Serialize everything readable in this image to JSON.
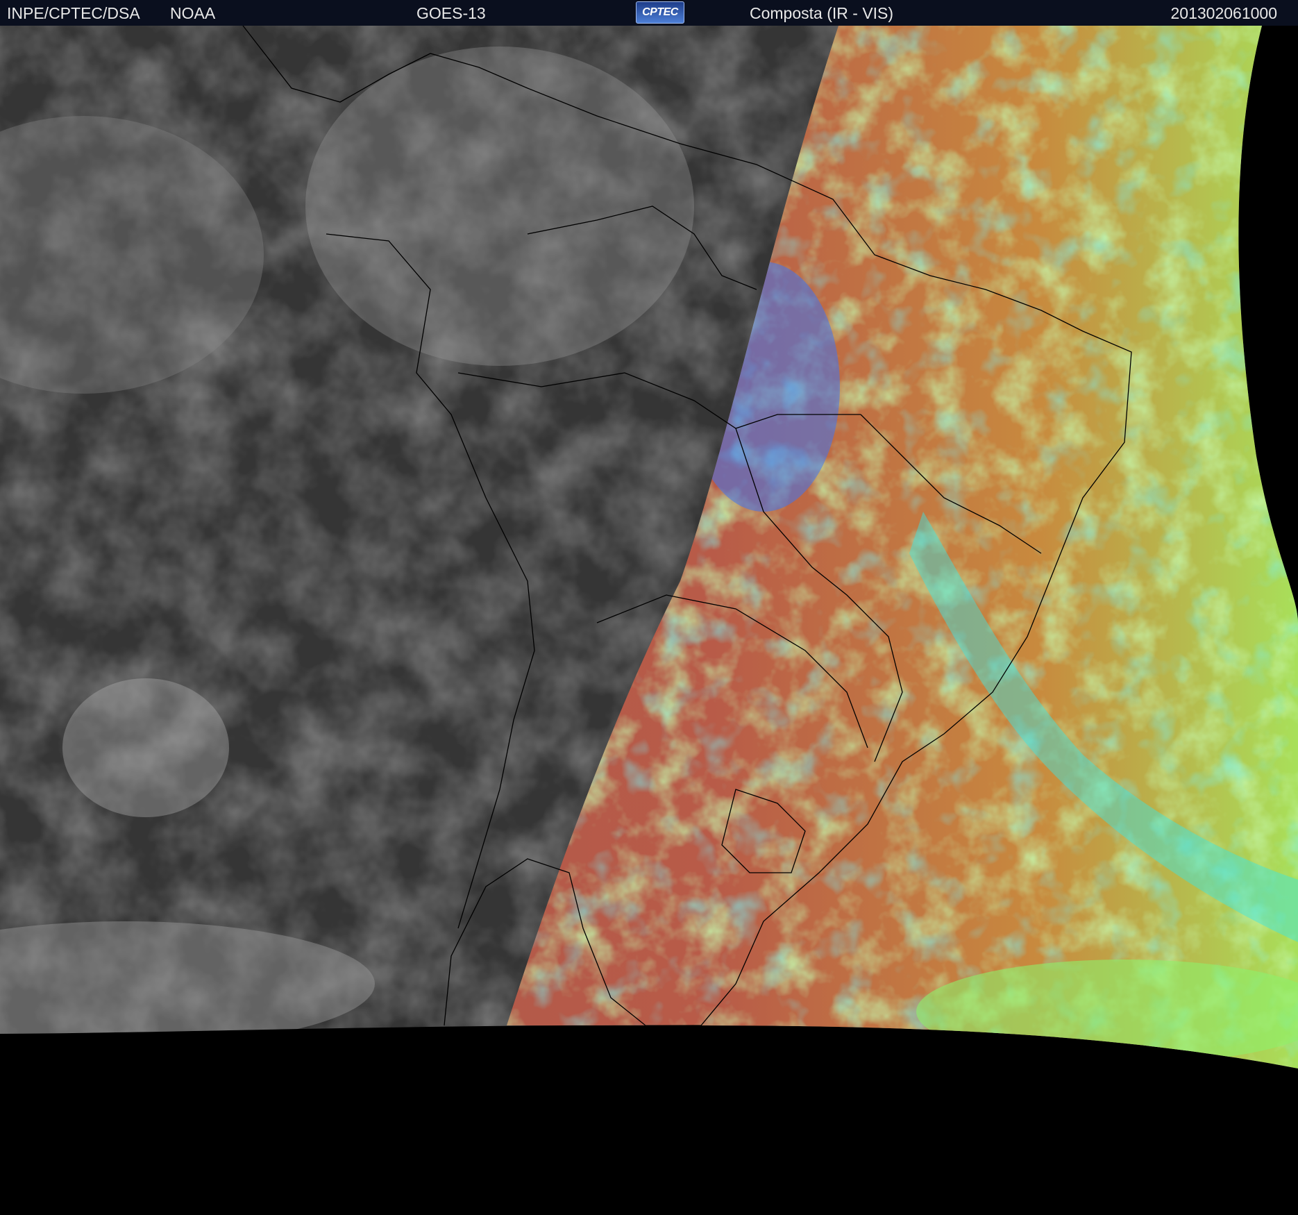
{
  "header": {
    "org": "INPE/CPTEC/DSA",
    "agency": "NOAA",
    "satellite": "GOES-13",
    "logo_text": "CPTEC",
    "product": "Composta (IR - VIS)",
    "timestamp": "201302061000"
  },
  "colors": {
    "header_bg": "#0a0f1e",
    "header_text": "#e8e8e8",
    "night_ir": "#3a3a3a",
    "day_vis_surface": "#b3554a",
    "day_vis_cloud_low": "#8ef06a",
    "day_vis_cloud_ice": "#37e6e6",
    "deep_convection": "#3f74f0",
    "borders": "#000000",
    "space": "#000000"
  }
}
